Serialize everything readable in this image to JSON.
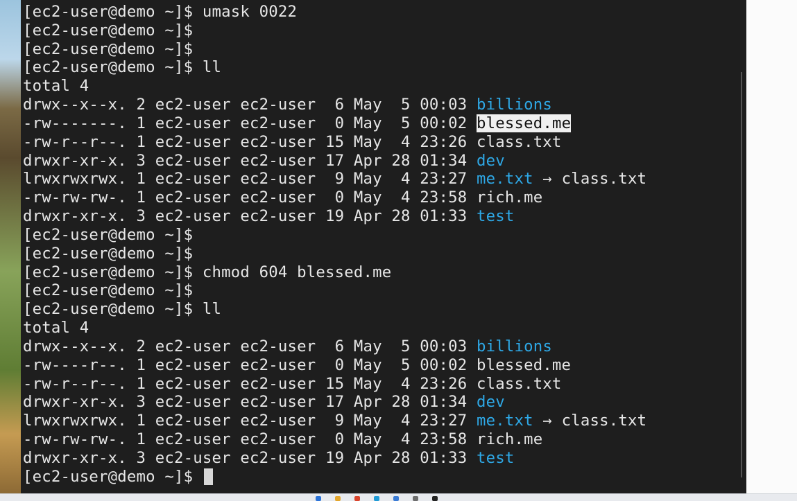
{
  "terminal": {
    "lines": [
      {
        "segments": [
          {
            "t": "[ec2-user@demo ~]$ umask 0022"
          }
        ]
      },
      {
        "segments": [
          {
            "t": "[ec2-user@demo ~]$"
          }
        ]
      },
      {
        "segments": [
          {
            "t": "[ec2-user@demo ~]$"
          }
        ]
      },
      {
        "segments": [
          {
            "t": "[ec2-user@demo ~]$ ll"
          }
        ]
      },
      {
        "segments": [
          {
            "t": "total 4"
          }
        ]
      },
      {
        "segments": [
          {
            "t": "drwx--x--x. 2 ec2-user ec2-user  6 May  5 00:03 "
          },
          {
            "t": "billions",
            "c": "blue"
          }
        ]
      },
      {
        "segments": [
          {
            "t": "-rw-------. 1 ec2-user ec2-user  0 May  5 00:02 "
          },
          {
            "t": "blessed.me",
            "c": "sel"
          }
        ]
      },
      {
        "segments": [
          {
            "t": "-rw-r--r--. 1 ec2-user ec2-user 15 May  4 23:26 class.txt"
          }
        ]
      },
      {
        "segments": [
          {
            "t": "drwxr-xr-x. 3 ec2-user ec2-user 17 Apr 28 01:34 "
          },
          {
            "t": "dev",
            "c": "blue"
          }
        ]
      },
      {
        "segments": [
          {
            "t": "lrwxrwxrwx. 1 ec2-user ec2-user  9 May  4 23:27 "
          },
          {
            "t": "me.txt",
            "c": "blue"
          },
          {
            "t": " → class.txt"
          }
        ]
      },
      {
        "segments": [
          {
            "t": "-rw-rw-rw-. 1 ec2-user ec2-user  0 May  4 23:58 rich.me"
          }
        ]
      },
      {
        "segments": [
          {
            "t": "drwxr-xr-x. 3 ec2-user ec2-user 19 Apr 28 01:33 "
          },
          {
            "t": "test",
            "c": "blue"
          }
        ]
      },
      {
        "segments": [
          {
            "t": "[ec2-user@demo ~]$"
          }
        ]
      },
      {
        "segments": [
          {
            "t": "[ec2-user@demo ~]$"
          }
        ]
      },
      {
        "segments": [
          {
            "t": "[ec2-user@demo ~]$ chmod 604 blessed.me"
          }
        ]
      },
      {
        "segments": [
          {
            "t": "[ec2-user@demo ~]$"
          }
        ]
      },
      {
        "segments": [
          {
            "t": "[ec2-user@demo ~]$ ll"
          }
        ]
      },
      {
        "segments": [
          {
            "t": "total 4"
          }
        ]
      },
      {
        "segments": [
          {
            "t": "drwx--x--x. 2 ec2-user ec2-user  6 May  5 00:03 "
          },
          {
            "t": "billions",
            "c": "blue"
          }
        ]
      },
      {
        "segments": [
          {
            "t": "-rw----r--. 1 ec2-user ec2-user  0 May  5 00:02 blessed.me"
          }
        ]
      },
      {
        "segments": [
          {
            "t": "-rw-r--r--. 1 ec2-user ec2-user 15 May  4 23:26 class.txt"
          }
        ]
      },
      {
        "segments": [
          {
            "t": "drwxr-xr-x. 3 ec2-user ec2-user 17 Apr 28 01:34 "
          },
          {
            "t": "dev",
            "c": "blue"
          }
        ]
      },
      {
        "segments": [
          {
            "t": "lrwxrwxrwx. 1 ec2-user ec2-user  9 May  4 23:27 "
          },
          {
            "t": "me.txt",
            "c": "blue"
          },
          {
            "t": " → class.txt"
          }
        ]
      },
      {
        "segments": [
          {
            "t": "-rw-rw-rw-. 1 ec2-user ec2-user  0 May  4 23:58 rich.me"
          }
        ]
      },
      {
        "segments": [
          {
            "t": "drwxr-xr-x. 3 ec2-user ec2-user 19 Apr 28 01:33 "
          },
          {
            "t": "test",
            "c": "blue"
          }
        ]
      },
      {
        "segments": [
          {
            "t": "[ec2-user@demo ~]$ "
          }
        ],
        "cursor": true
      }
    ]
  },
  "colors": {
    "background": "#1e1e1e",
    "text": "#e6e6e6",
    "directory": "#2ea8e6",
    "selection": "#f0f0f0"
  },
  "taskbar": {
    "icons": [
      "search-icon",
      "folder-icon",
      "browser-icon",
      "mail-icon",
      "store-icon",
      "settings-icon",
      "terminal-icon"
    ]
  }
}
